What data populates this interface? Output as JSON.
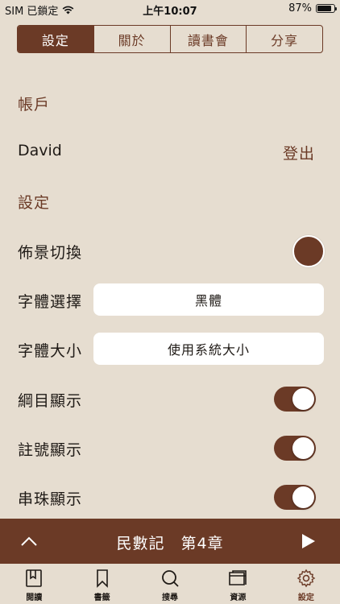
{
  "status_bar": {
    "carrier": "SIM 已鎖定",
    "time": "上午10:07",
    "battery": "87%",
    "battery_level": 0.87
  },
  "tabs_top": [
    {
      "label": "設定",
      "active": true
    },
    {
      "label": "關於",
      "active": false
    },
    {
      "label": "讀書會",
      "active": false
    },
    {
      "label": "分享",
      "active": false
    }
  ],
  "account": {
    "section_title": "帳戶",
    "username": "David",
    "logout_label": "登出"
  },
  "settings": {
    "section_title": "設定",
    "background_label": "佈景切換",
    "background_color": "#6B3A26",
    "font_label": "字體選擇",
    "font_value": "黑體",
    "size_label": "字體大小",
    "size_value": "使用系統大小",
    "outline_label": "綱目顯示",
    "outline_on": true,
    "notes_label": "註號顯示",
    "notes_on": true,
    "crossref_label": "串珠顯示",
    "crossref_on": true
  },
  "player": {
    "book": "民數記",
    "chapter": "第4章"
  },
  "tab_bar": [
    {
      "label": "閱讀",
      "icon": "book-icon",
      "active": false
    },
    {
      "label": "書籤",
      "icon": "bookmark-icon",
      "active": false
    },
    {
      "label": "搜尋",
      "icon": "search-icon",
      "active": false
    },
    {
      "label": "資源",
      "icon": "folder-icon",
      "active": false
    },
    {
      "label": "設定",
      "icon": "gear-icon",
      "active": true
    }
  ],
  "colors": {
    "accent": "#6B3A26",
    "background": "#E6DDD0"
  }
}
